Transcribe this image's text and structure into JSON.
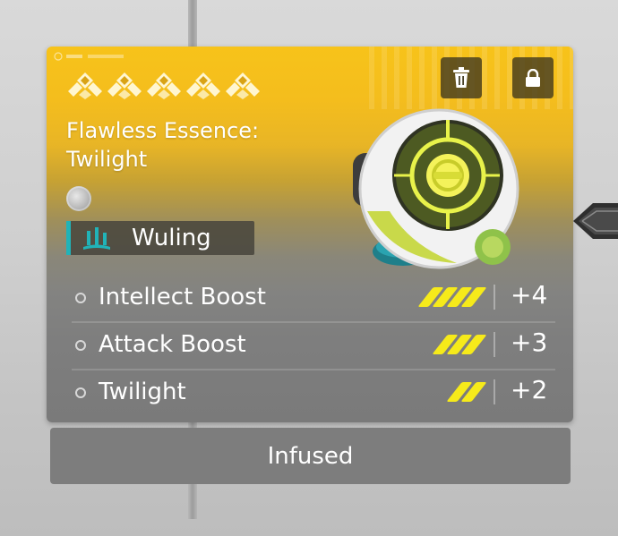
{
  "item": {
    "title": "Flawless Essence: Twilight",
    "rarity_stars": 5,
    "region": {
      "label": "Wuling",
      "icon": "wuling-region-icon"
    },
    "image": "essence-orb",
    "actions": [
      {
        "name": "discard",
        "icon": "trash-icon"
      },
      {
        "name": "lock",
        "icon": "lock-icon"
      }
    ],
    "attributes": [
      {
        "name": "Intellect Boost",
        "level": 4,
        "value": "+4"
      },
      {
        "name": "Attack Boost",
        "level": 3,
        "value": "+3"
      },
      {
        "name": "Twilight",
        "level": 2,
        "value": "+2"
      }
    ],
    "status": "Infused"
  },
  "colors": {
    "header_gold": "#f7c31a",
    "pip_yellow": "#f6ea1a",
    "region_accent": "#21b3b8"
  }
}
